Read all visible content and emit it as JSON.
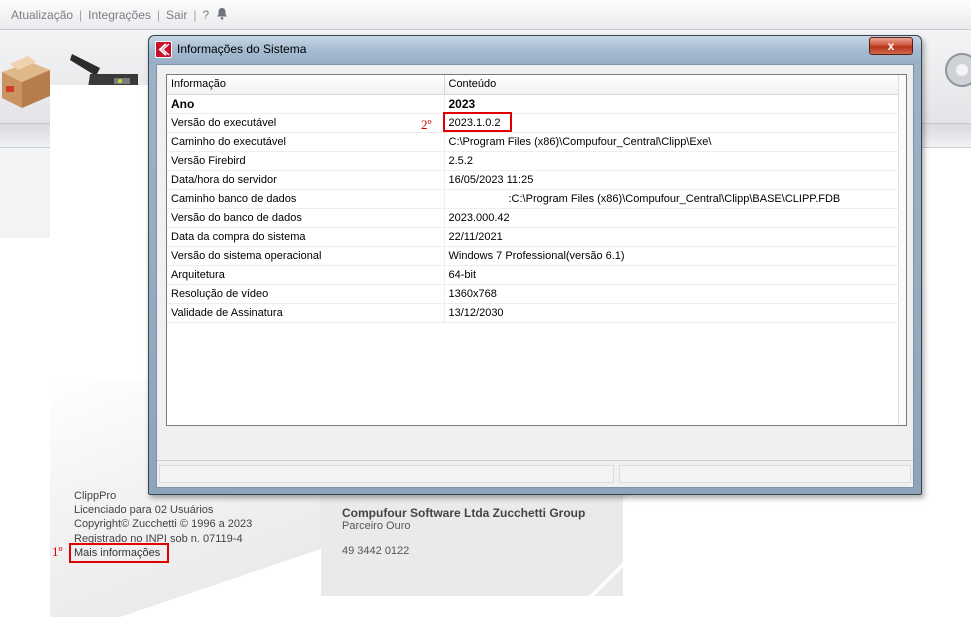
{
  "menu": {
    "items": [
      "Atualização",
      "Integrações",
      "Sair",
      "?"
    ],
    "bell_icon": "bell-icon"
  },
  "license": {
    "product": "ClippPro",
    "licensed": "Licenciado para 02 Usuários",
    "copyright": "Copyright© Zucchetti © 1996 a 2023",
    "registry": "Registrado no INPI sob n. 07119-4",
    "more_link": "Mais informações"
  },
  "company": {
    "name": "Compufour Software Ltda Zucchetti Group",
    "partner": "Parceiro Ouro",
    "phone": "49 3442 0122"
  },
  "annotations": {
    "first": "1º",
    "second": "2º",
    "highlight_color": "#e00000"
  },
  "dialog": {
    "title": "Informações do Sistema",
    "close": "x",
    "columns": [
      "Informação",
      "Conteúdo"
    ],
    "rows": [
      {
        "label": "Ano",
        "value": "2023"
      },
      {
        "label": "Versão do executável",
        "value": "2023.1.0.2"
      },
      {
        "label": "Caminho do executável",
        "value": "C:\\Program Files (x86)\\Compufour_Central\\Clipp\\Exe\\"
      },
      {
        "label": "Versão Firebird",
        "value": "2.5.2"
      },
      {
        "label": "Data/hora do servidor",
        "value": "16/05/2023 11:25"
      },
      {
        "label": "Caminho banco de dados",
        "value": ":C:\\Program Files (x86)\\Compufour_Central\\Clipp\\BASE\\CLIPP.FDB"
      },
      {
        "label": "Versão do banco de dados",
        "value": "2023.000.42"
      },
      {
        "label": "Data da compra do sistema",
        "value": "22/11/2021"
      },
      {
        "label": "Versão do sistema operacional",
        "value": "Windows 7 Professional(versão 6.1)"
      },
      {
        "label": "Arquitetura",
        "value": "64-bit"
      },
      {
        "label": "Resolução de vídeo",
        "value": "1360x768"
      },
      {
        "label": "Validade de Assinatura",
        "value": "13/12/2030"
      }
    ]
  },
  "colors": {
    "titlebar": "#a6bbd1",
    "close_button": "#c8432b",
    "brand": "#c8102e"
  }
}
